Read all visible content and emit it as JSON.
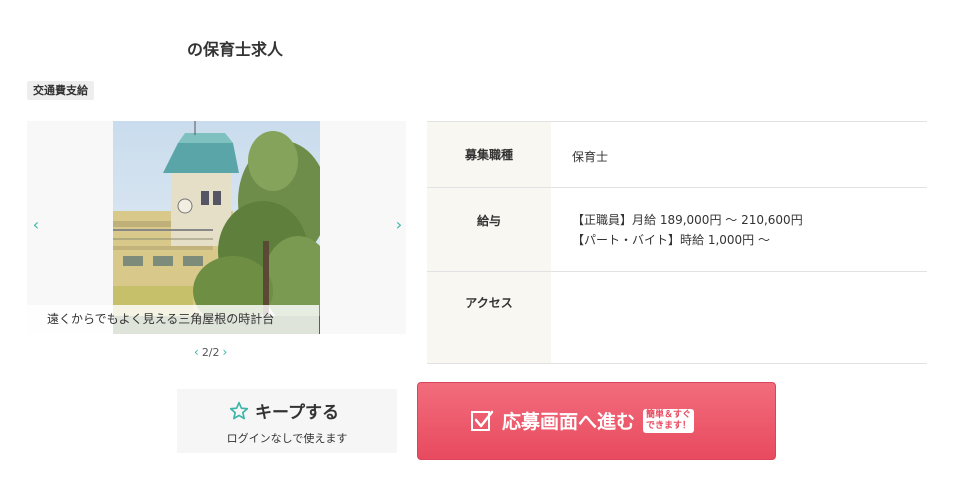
{
  "header": {
    "title": "の保育士求人",
    "badge": "交通費支給"
  },
  "gallery": {
    "caption": "遠くからでもよく見える三角屋根の時計台",
    "pager": "2/2",
    "prev_icon": "chevron-left-icon",
    "next_icon": "chevron-right-icon"
  },
  "info": {
    "rows": [
      {
        "label": "募集職種",
        "value_lines": [
          "保育士"
        ]
      },
      {
        "label": "給与",
        "value_lines": [
          "【正職員】月給 189,000円 ～ 210,600円",
          "【パート・バイト】時給 1,000円 ～"
        ]
      },
      {
        "label": "アクセス",
        "value_lines": []
      }
    ]
  },
  "keep": {
    "label": "キープする",
    "sub": "ログインなしで使えます",
    "icon": "star-outline-icon"
  },
  "apply": {
    "label": "応募画面へ進む",
    "badge_line1": "簡単＆すぐ",
    "badge_line2": "できます！",
    "icon": "checkbox-check-icon"
  },
  "colors": {
    "accent": "#3ab5a8",
    "apply_bg": "#e84a5f",
    "table_header_bg": "#f8f7f2"
  }
}
